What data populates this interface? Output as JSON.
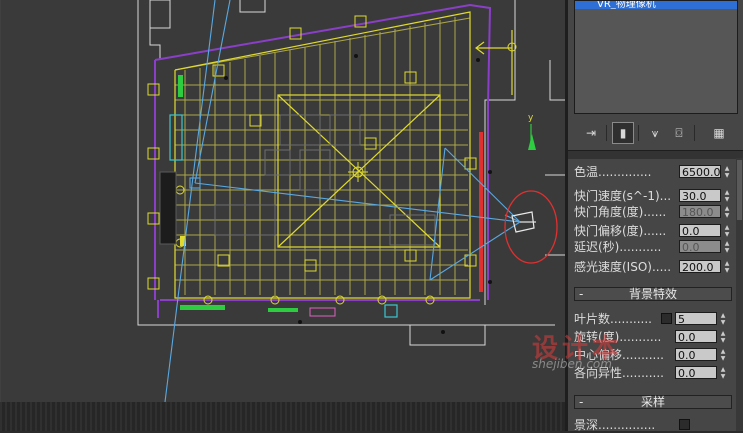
{
  "object_list": {
    "selected_item": "VR_物理像机"
  },
  "panel": {
    "rows_top": [
      {
        "label": "色温..............",
        "value": "6500.0",
        "enabled": true
      },
      {
        "label": "快门速度(s^-1)...",
        "value": "30.0",
        "enabled": true
      },
      {
        "label": "快门角度(度)......",
        "value": "180.0",
        "enabled": false
      },
      {
        "label": "快门偏移(度)......",
        "value": "0.0",
        "enabled": true
      },
      {
        "label": "延迟(秒)...........",
        "value": "0.0",
        "enabled": false
      },
      {
        "label": "感光速度(ISO).....",
        "value": "200.0",
        "enabled": true
      }
    ],
    "bokeh_rollout": {
      "title": "背景特效",
      "rows": [
        {
          "label": "叶片数...........",
          "value": "5"
        },
        {
          "label": "旋转(度)...........",
          "value": "0.0"
        },
        {
          "label": "中心偏移...........",
          "value": "0.0"
        },
        {
          "label": "各向异性...........",
          "value": "0.0"
        }
      ]
    },
    "sampling_rollout": {
      "title": "采样",
      "first_row_label": "景深..............."
    }
  },
  "watermark": {
    "logo": "设计本",
    "url": "shejiben.com"
  },
  "colors": {
    "accent": "#2e6fd6",
    "viewport_bg": "#3a3a3a",
    "wire_yellow": "#d8d22c",
    "wire_purple": "#8a3fc8",
    "camera_blue": "#5aa8e0",
    "highlight_red": "#e03030"
  }
}
